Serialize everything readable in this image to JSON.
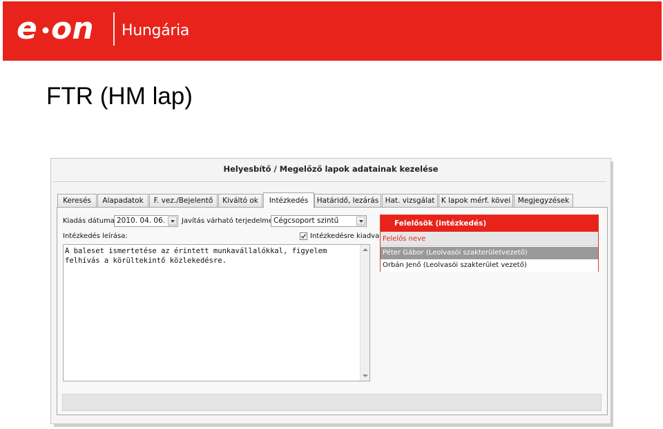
{
  "header": {
    "brand": "e·on",
    "region": "Hungária",
    "colors": {
      "brand_red": "#e8231b"
    }
  },
  "slide": {
    "title": "FTR (HM lap)"
  },
  "window": {
    "title": "Helyesbítő / Megelőző lapok adatainak kezelése",
    "tabs": [
      {
        "label": "Keresés"
      },
      {
        "label": "Alapadatok"
      },
      {
        "label": "F. vez./Bejelentő"
      },
      {
        "label": "Kiváltó ok"
      },
      {
        "label": "Intézkedés",
        "active": true
      },
      {
        "label": "Határidő, lezárás"
      },
      {
        "label": "Hat. vizsgálat"
      },
      {
        "label": "K lapok mérf. kövei"
      },
      {
        "label": "Megjegyzések"
      }
    ]
  },
  "form": {
    "issue_date_label": "Kiadás dátuma:",
    "issue_date_value": "2010. 04. 06.",
    "fix_scope_label": "Javítás várható terjedelme:",
    "fix_scope_value": "Cégcsoport szintű",
    "action_desc_label": "Intézkedés leírása:",
    "issued_checkbox_label": "Intézkedésre kiadva",
    "issued_checked": true,
    "action_desc_lines": [
      "A baleset ismertetése az érintett munkavállalókkal, figyelem",
      "felhívás a körültekintő közlekedésre."
    ]
  },
  "responsibles": {
    "header": "Felelősök (intézkedés)",
    "column": "Felelős neve",
    "rows": [
      {
        "name": "Péter Gábor (Leolvasói szakterületvezető)",
        "selected": true
      },
      {
        "name": "Orbán Jenő (Leolvasói szakterület vezető)",
        "selected": false
      }
    ]
  }
}
